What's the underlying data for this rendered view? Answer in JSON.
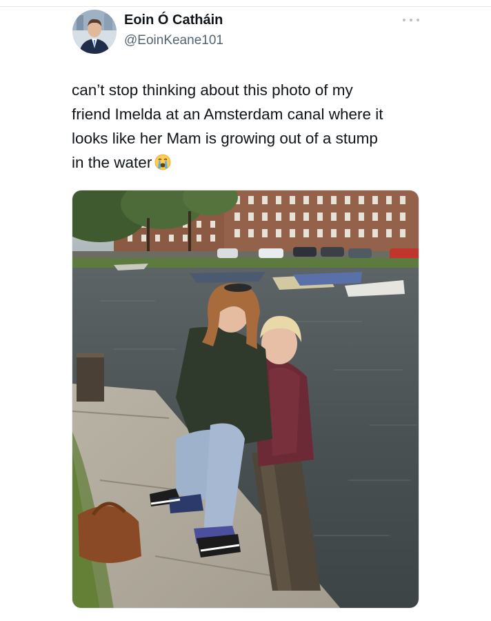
{
  "tweet": {
    "author_name": "Eoin Ó Catháin",
    "author_handle": "@EoinKeane101",
    "text_lines": [
      "can’t stop thinking about this photo of my",
      "friend Imelda at an Amsterdam canal where it",
      "looks like her Mam is growing out of a stump",
      "in the water"
    ],
    "emoji": "loudly-crying-face",
    "more_icon": "ellipsis-icon",
    "photo": "two-women-at-amsterdam-canal-photo"
  },
  "colors": {
    "text_primary": "#0f1419",
    "text_secondary": "#536471",
    "background": "#ffffff"
  }
}
